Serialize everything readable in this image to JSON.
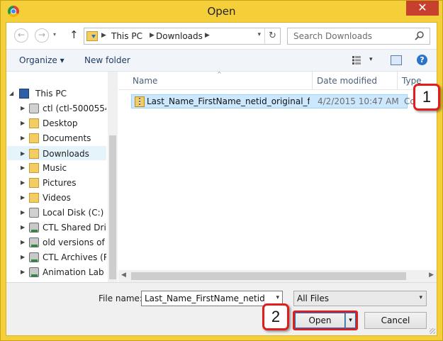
{
  "window": {
    "title": "Open",
    "close_glyph": "✕",
    "app_icon": "chrome-icon"
  },
  "navbar": {
    "back_glyph": "←",
    "forward_glyph": "→",
    "history_glyph": "▾",
    "up_glyph": "↑",
    "breadcrumbs": [
      "This PC",
      "Downloads"
    ],
    "crumb_separator": "▶",
    "address_dropdown_glyph": "▾",
    "refresh_glyph": "↻",
    "search_placeholder": "Search Downloads"
  },
  "toolbar": {
    "organize_label": "Organize ▾",
    "new_folder_label": "New folder",
    "view_dropdown_glyph": "▾",
    "help_glyph": "?"
  },
  "nav_tree": {
    "items": [
      {
        "label": "This PC",
        "icon": "computer-icon"
      },
      {
        "label": "ctl (ctl-5000554)",
        "icon": "user-drive-icon"
      },
      {
        "label": "Desktop",
        "icon": "folder-icon"
      },
      {
        "label": "Documents",
        "icon": "folder-icon"
      },
      {
        "label": "Downloads",
        "icon": "folder-icon",
        "selected": true
      },
      {
        "label": "Music",
        "icon": "folder-icon"
      },
      {
        "label": "Pictures",
        "icon": "folder-icon"
      },
      {
        "label": "Videos",
        "icon": "folder-icon"
      },
      {
        "label": "Local Disk (C:)",
        "icon": "drive-icon"
      },
      {
        "label": "CTL Shared Drive",
        "icon": "network-drive-icon"
      },
      {
        "label": "old versions of fil",
        "icon": "network-drive-icon"
      },
      {
        "label": "CTL Archives (R:)",
        "icon": "network-drive-icon"
      },
      {
        "label": "Animation Lab (S",
        "icon": "network-drive-icon"
      }
    ],
    "expand_glyph": "▶"
  },
  "file_list": {
    "columns": [
      "Name",
      "Date modified",
      "Type"
    ],
    "sort_glyph": "^",
    "files": [
      {
        "name": "Last_Name_FirstName_netid_original_file...",
        "date": "4/2/2015 10:47 AM",
        "type": "Cor",
        "selected": true
      }
    ],
    "scroll_left_glyph": "◀",
    "scroll_right_glyph": "▶"
  },
  "footer": {
    "file_name_label": "File name:",
    "file_name_value": "Last_Name_FirstName_netid_origi",
    "file_name_dd_glyph": "▾",
    "filter_value": "All Files",
    "filter_dd_glyph": "▾",
    "open_label": "Open",
    "open_dd_glyph": "▾",
    "cancel_label": "Cancel"
  },
  "callouts": [
    "1",
    "2"
  ],
  "colors": {
    "window_frame": "#f5cf3a",
    "close_button": "#c7402e",
    "selection": "#cce8ff",
    "callout_border": "#e21d1d"
  }
}
